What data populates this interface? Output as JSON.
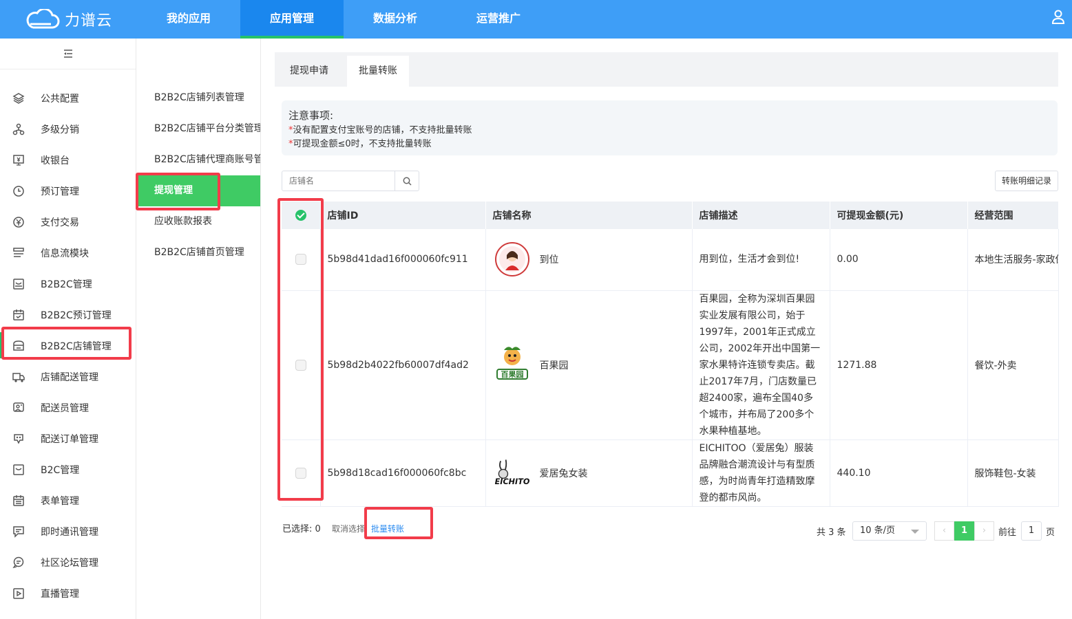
{
  "brand": "力谱云",
  "topnav": [
    "我的应用",
    "应用管理",
    "数据分析",
    "运营推广"
  ],
  "sidebar": [
    {
      "label": "公共配置",
      "icon": "layers-icon"
    },
    {
      "label": "多级分销",
      "icon": "distribution-icon"
    },
    {
      "label": "收银台",
      "icon": "cashier-icon"
    },
    {
      "label": "预订管理",
      "icon": "clock-icon"
    },
    {
      "label": "支付交易",
      "icon": "payment-icon"
    },
    {
      "label": "信息流模块",
      "icon": "feed-icon"
    },
    {
      "label": "B2B2C管理",
      "icon": "store-icon"
    },
    {
      "label": "B2B2C预订管理",
      "icon": "calendar-icon"
    },
    {
      "label": "B2B2C店铺管理",
      "icon": "shop-icon"
    },
    {
      "label": "店铺配送管理",
      "icon": "truck-icon"
    },
    {
      "label": "配送员管理",
      "icon": "courier-icon"
    },
    {
      "label": "配送订单管理",
      "icon": "order-icon"
    },
    {
      "label": "B2C管理",
      "icon": "b2c-icon"
    },
    {
      "label": "表单管理",
      "icon": "form-icon"
    },
    {
      "label": "即时通讯管理",
      "icon": "chat-icon"
    },
    {
      "label": "社区论坛管理",
      "icon": "forum-icon"
    },
    {
      "label": "直播管理",
      "icon": "live-icon"
    }
  ],
  "submenu": [
    "B2B2C店铺列表管理",
    "B2B2C店铺平台分类管理",
    "B2B2C店铺代理商账号管理",
    "提现管理",
    "应收账款报表",
    "B2B2C店铺首页管理"
  ],
  "tabs": [
    "提现申请",
    "批量转账"
  ],
  "notice": {
    "title": "注意事项:",
    "lines": [
      "没有配置支付宝账号的店铺，不支持批量转账",
      "可提现金额≤0时，不支持批量转账"
    ]
  },
  "search_placeholder": "店铺名",
  "record_button": "转账明细记录",
  "columns": [
    "店铺ID",
    "店铺名称",
    "店铺描述",
    "可提现金额(元)",
    "经营范围"
  ],
  "rows": [
    {
      "id": "5b98d41dad16f000060fc911",
      "name": "到位",
      "desc": "用到位，生活才会到位!",
      "amount": "0.00",
      "scope": "本地生活服务-家政保洁"
    },
    {
      "id": "5b98d2b4022fb60007df4ad2",
      "name": "百果园",
      "desc": "百果园，全称为深圳百果园实业发展有限公司，始于1997年，2001年正式成立公司，2002年开出中国第一家水果特许连锁专卖店。截止2017年7月，门店数量已超2400家，遍布全国40多个城市，并布局了200多个水果种植基地。",
      "amount": "1271.88",
      "scope": "餐饮-外卖"
    },
    {
      "id": "5b98d18cad16f000060fc8bc",
      "name": "爱居兔女装",
      "desc": "EICHITOO（爱居兔）服装品牌融合潮流设计与有型质感，为时尚青年打造精致摩登的都市风尚。",
      "amount": "440.10",
      "scope": "服饰鞋包-女装"
    }
  ],
  "logos": {
    "baiguoyuan": "百果园",
    "eichitoo": "EICHITO"
  },
  "footer": {
    "selected": "已选择: 0",
    "cancel": "取消选择",
    "batch": "批量转账",
    "total": "共 3 条",
    "page_size": "10 条/页",
    "current_page": "1",
    "goto_label": "前往",
    "goto_value": "1",
    "page_unit": "页"
  },
  "colors": {
    "primary": "#3e9ef7",
    "accent": "#3fcb64",
    "highlight": "#f23c4a",
    "link": "#2d8cf0"
  }
}
